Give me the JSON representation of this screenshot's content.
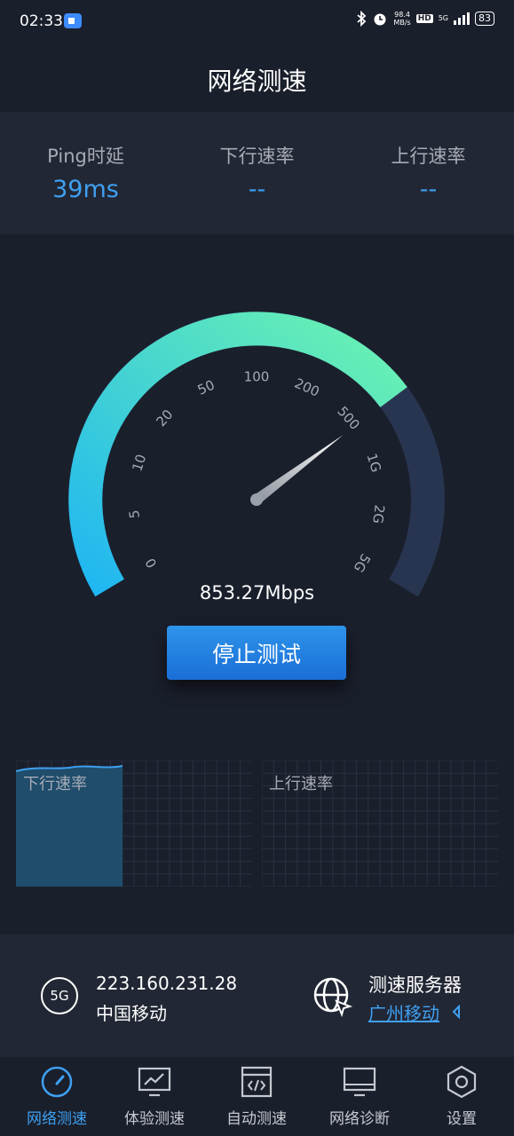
{
  "status_bar": {
    "time": "02:33",
    "net_speed_value": "98.4",
    "net_speed_unit": "MB/s",
    "hd": "HD",
    "network_type": "5G",
    "battery": "83"
  },
  "header": {
    "title": "网络测速"
  },
  "stats": [
    {
      "label": "Ping时延",
      "value": "39ms"
    },
    {
      "label": "下行速率",
      "value": "--"
    },
    {
      "label": "上行速率",
      "value": "--"
    }
  ],
  "gauge": {
    "ticks": [
      "0",
      "5",
      "10",
      "20",
      "50",
      "100",
      "200",
      "500",
      "1G",
      "2G",
      "5G"
    ],
    "speed_text": "853.27Mbps",
    "progress_fraction": 0.72,
    "colors": {
      "progress_start": "#1fb6f2",
      "progress_end": "#6cf3b0",
      "track": "#283550"
    }
  },
  "actions": {
    "stop_label": "停止测试"
  },
  "charts": {
    "download_label": "下行速率",
    "upload_label": "上行速率"
  },
  "info": {
    "network_badge": "5G",
    "ip": "223.160.231.28",
    "carrier": "中国移动",
    "server_label": "测速服务器",
    "server_name": "广州移动"
  },
  "nav": {
    "items": [
      {
        "label": "网络测速",
        "icon": "speedometer-icon",
        "active": true
      },
      {
        "label": "体验测速",
        "icon": "monitor-chart-icon",
        "active": false
      },
      {
        "label": "自动测速",
        "icon": "code-window-icon",
        "active": false
      },
      {
        "label": "网络诊断",
        "icon": "desktop-icon",
        "active": false
      },
      {
        "label": "设置",
        "icon": "settings-icon",
        "active": false
      }
    ]
  },
  "accent_color": "#3ea0f1"
}
